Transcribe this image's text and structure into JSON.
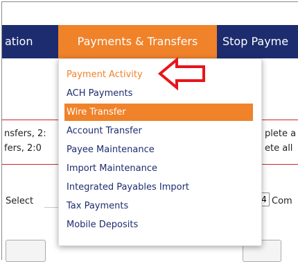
{
  "nav": {
    "items": [
      {
        "label": "ation"
      },
      {
        "label": "Payments & Transfers"
      },
      {
        "label": "Stop Payme"
      }
    ]
  },
  "background": {
    "left_line_1": "nsfers, 2:",
    "left_line_2": "fers, 2:0",
    "right_line_1": "plete a",
    "right_line_2": "ete all",
    "select_label": "Select",
    "right_select_value": "4",
    "right_select_text": "Com"
  },
  "menu": {
    "items": [
      {
        "label": "Payment Activity"
      },
      {
        "label": "ACH Payments"
      },
      {
        "label": "Wire Transfer"
      },
      {
        "label": "Account Transfer"
      },
      {
        "label": "Payee Maintenance"
      },
      {
        "label": "Import Maintenance"
      },
      {
        "label": "Integrated Payables Import"
      },
      {
        "label": "Tax Payments"
      },
      {
        "label": "Mobile Deposits"
      }
    ],
    "active_color": "#f0822a",
    "highlight_color": "#f0822a",
    "text_color": "#1d2c6e"
  },
  "annotation": {
    "arrow_color": "#e8141c",
    "icon": "arrow-left-icon"
  }
}
